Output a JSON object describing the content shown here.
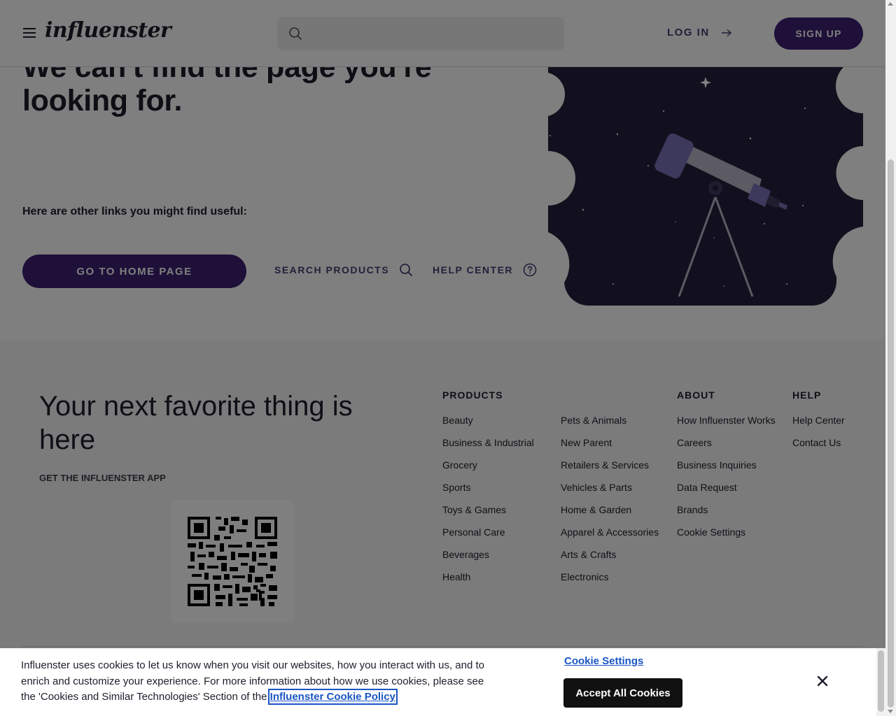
{
  "header": {
    "logo": "influenster",
    "search_placeholder": "",
    "login_label": "LOG IN",
    "signup_label": "SIGN UP"
  },
  "hero": {
    "title": "We can't find the page you're looking for.",
    "links_heading": "Here are other links you might find useful:",
    "home_button": "GO TO HOME PAGE",
    "search_products": "SEARCH PRODUCTS",
    "help_center": "HELP CENTER"
  },
  "footer": {
    "title": "Your next favorite thing is here",
    "app_label": "GET THE INFLUENSTER APP",
    "products_heading": "PRODUCTS",
    "products_col1": [
      "Beauty",
      "Business & Industrial",
      "Grocery",
      "Sports",
      "Toys & Games",
      "Personal Care",
      "Beverages",
      "Health"
    ],
    "products_col2": [
      "Pets & Animals",
      "New Parent",
      "Retailers & Services",
      "Vehicles & Parts",
      "Home & Garden",
      "Apparel & Accessories",
      "Arts & Crafts",
      "Electronics"
    ],
    "about_heading": "ABOUT",
    "about_links": [
      "How Influenster Works",
      "Careers",
      "Business Inquiries",
      "Data Request",
      "Brands",
      "Cookie Settings"
    ],
    "help_heading": "HELP",
    "help_links": [
      "Help Center",
      "Contact Us"
    ]
  },
  "cookie_banner": {
    "text": "Influenster uses cookies to let us know when you visit our websites, how you interact with us, and to enrich and customize your experience. For more information about how we use cookies, please see the 'Cookies and Similar Technologies' Section of the",
    "policy_link": "Influenster Cookie Policy",
    "settings_label": "Cookie Settings",
    "accept_label": "Accept All Cookies"
  },
  "colors": {
    "brand_purple": "#3c2173",
    "illustration_navy": "#24213d",
    "telescope_violet": "#7a72b8",
    "cookie_link_blue": "#1a55c4"
  },
  "icons": [
    "menu-icon",
    "search-icon",
    "arrow-right-icon",
    "help-circle-icon",
    "close-icon",
    "qr-code"
  ]
}
